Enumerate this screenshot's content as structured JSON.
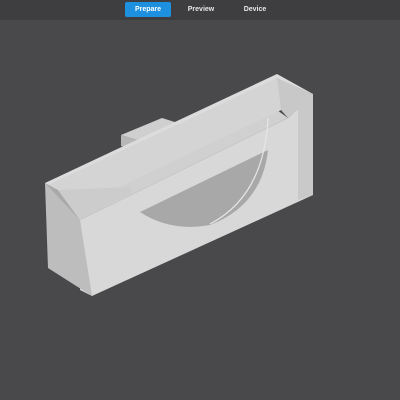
{
  "tabs": {
    "prepare": "Prepare",
    "preview": "Preview",
    "device": "Device"
  },
  "colors": {
    "background": "#49494b",
    "top_bar": "#3e3e40",
    "active_tab": "#1e90e0",
    "model_light": "#d6d6d6",
    "model_mid": "#c4c4c4",
    "model_dark": "#ababab"
  }
}
